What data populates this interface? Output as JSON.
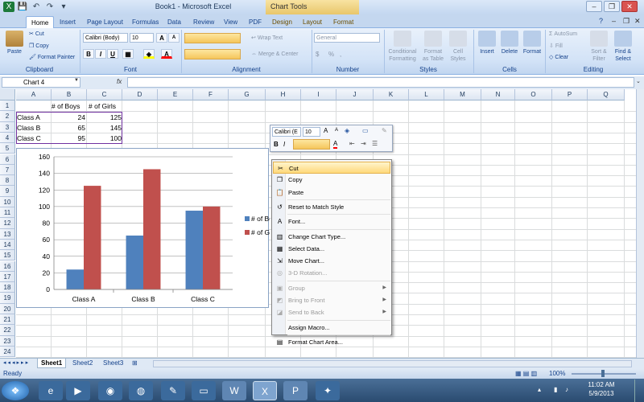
{
  "window": {
    "title": "Book1 - Microsoft Excel",
    "chart_tools_label": "Chart Tools"
  },
  "ribbon_tabs": [
    "Home",
    "Insert",
    "Page Layout",
    "Formulas",
    "Data",
    "Review",
    "View",
    "PDF",
    "Design",
    "Layout",
    "Format"
  ],
  "clipboard": {
    "paste": "Paste",
    "cut": "Cut",
    "copy": "Copy",
    "format_painter": "Format Painter",
    "group": "Clipboard"
  },
  "font": {
    "name": "Calibri (Body)",
    "size": "10",
    "group": "Font",
    "bold": "B",
    "italic": "I",
    "underline": "U",
    "grow": "A",
    "shrink": "A"
  },
  "alignment": {
    "wrap_text": "Wrap Text",
    "merge": "Merge & Center",
    "group": "Alignment"
  },
  "number": {
    "format": "General",
    "group": "Number",
    "currency": "$",
    "percent": "%",
    "comma": ","
  },
  "styles": {
    "conditional": "Conditional Formatting",
    "format_table": "Format as Table",
    "cell_styles": "Cell Styles",
    "group": "Styles"
  },
  "cells": {
    "insert": "Insert",
    "delete": "Delete",
    "format": "Format",
    "group": "Cells"
  },
  "editing": {
    "autosum": "AutoSum",
    "fill": "Fill",
    "clear": "Clear",
    "sort": "Sort & Filter",
    "find": "Find & Select",
    "group": "Editing"
  },
  "formula_bar": {
    "name_box": "Chart 4",
    "fx": "fx"
  },
  "columns": [
    "A",
    "B",
    "C",
    "D",
    "E",
    "F",
    "G",
    "H",
    "I",
    "J",
    "K",
    "L",
    "M",
    "N",
    "O",
    "P",
    "Q"
  ],
  "rows": [
    "1",
    "2",
    "3",
    "4",
    "5",
    "6",
    "7",
    "8",
    "9",
    "10",
    "11",
    "12",
    "13",
    "14",
    "15",
    "16",
    "17",
    "18",
    "19",
    "20",
    "21",
    "22",
    "23",
    "24"
  ],
  "table": {
    "headers": [
      "# of Boys",
      "# of Girls"
    ],
    "rows": [
      {
        "label": "Class A",
        "boys": "24",
        "girls": "125"
      },
      {
        "label": "Class B",
        "boys": "65",
        "girls": "145"
      },
      {
        "label": "Class C",
        "boys": "95",
        "girls": "100"
      }
    ]
  },
  "chart_data": {
    "type": "bar",
    "categories": [
      "Class A",
      "Class B",
      "Class C"
    ],
    "series": [
      {
        "name": "# of Boys",
        "values": [
          24,
          65,
          95
        ],
        "color": "#4f81bd"
      },
      {
        "name": "# of Girls",
        "values": [
          125,
          145,
          100
        ],
        "color": "#c0504d"
      }
    ],
    "ylim": [
      0,
      160
    ],
    "yticks": [
      0,
      20,
      40,
      60,
      80,
      100,
      120,
      140,
      160
    ],
    "grid": true,
    "legend": "right",
    "legend_visible_text": [
      "# of Boy",
      "# of Gi"
    ]
  },
  "mini_toolbar": {
    "font": "Calibri (E",
    "size": "10"
  },
  "context_menu": [
    {
      "label": "Cut",
      "icon": "scissors-icon",
      "glyph": "✂",
      "enabled": true,
      "highlighted": true
    },
    {
      "label": "Copy",
      "icon": "copy-icon",
      "glyph": "❐",
      "enabled": true
    },
    {
      "label": "Paste",
      "icon": "paste-icon",
      "glyph": "📋",
      "enabled": true
    },
    {
      "sep": true
    },
    {
      "label": "Reset to Match Style",
      "icon": "reset-style-icon",
      "glyph": "↺",
      "enabled": true
    },
    {
      "sep": true
    },
    {
      "label": "Font...",
      "icon": "font-icon",
      "glyph": "A",
      "enabled": true
    },
    {
      "sep": true
    },
    {
      "label": "Change Chart Type...",
      "icon": "chart-type-icon",
      "glyph": "▥",
      "enabled": true
    },
    {
      "label": "Select Data...",
      "icon": "select-data-icon",
      "glyph": "▦",
      "enabled": true
    },
    {
      "label": "Move Chart...",
      "icon": "move-chart-icon",
      "glyph": "⇲",
      "enabled": true
    },
    {
      "label": "3-D Rotation...",
      "icon": "rotation-icon",
      "glyph": "◎",
      "enabled": false
    },
    {
      "sep": true
    },
    {
      "label": "Group",
      "icon": "group-icon",
      "glyph": "▣",
      "enabled": false,
      "submenu": true
    },
    {
      "label": "Bring to Front",
      "icon": "bring-front-icon",
      "glyph": "◩",
      "enabled": false,
      "submenu": true
    },
    {
      "label": "Send to Back",
      "icon": "send-back-icon",
      "glyph": "◪",
      "enabled": false,
      "submenu": true
    },
    {
      "sep": true
    },
    {
      "label": "Assign Macro...",
      "icon": "macro-icon",
      "glyph": "",
      "enabled": true
    },
    {
      "sep": true
    },
    {
      "label": "Format Chart Area...",
      "icon": "format-area-icon",
      "glyph": "▤",
      "enabled": true
    }
  ],
  "sheets": [
    "Sheet1",
    "Sheet2",
    "Sheet3"
  ],
  "status": {
    "ready": "Ready",
    "zoom": "100%"
  },
  "taskbar": {
    "time": "11:02 AM",
    "date": "5/9/2013"
  }
}
